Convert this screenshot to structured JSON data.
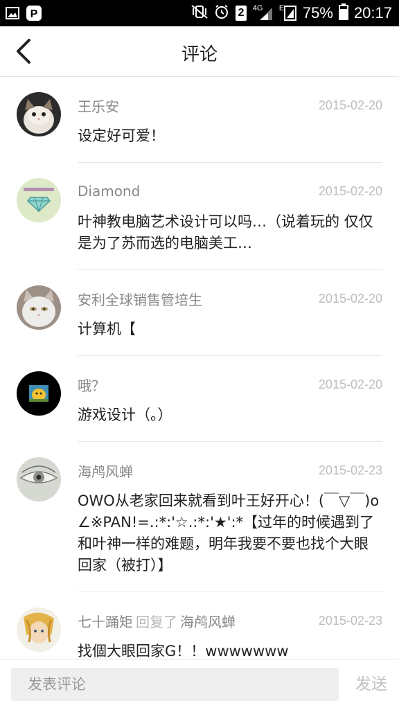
{
  "status_bar": {
    "network_type": "4G",
    "sim_slot": "2",
    "roaming_indicator": "E",
    "battery_percent": "75%",
    "time": "20:17"
  },
  "header": {
    "title": "评论"
  },
  "comments": [
    {
      "user": "王乐安",
      "date": "2015-02-20",
      "text": "设定好可爱！"
    },
    {
      "user": "Diamond",
      "date": "2015-02-20",
      "text": "叶神教电脑艺术设计可以吗…（说着玩的 仅仅是为了苏而选的电脑美工…"
    },
    {
      "user": "安利全球销售管培生",
      "date": "2015-02-20",
      "text": "计算机【"
    },
    {
      "user": "哦？",
      "date": "2015-02-20",
      "text": "游戏设计（。）"
    },
    {
      "user": "海鸬风蝉",
      "date": "2015-02-23",
      "text": "OWO从老家回来就看到叶王好开心！(￣▽￣)o∠※PAN!=.:*:'☆.:*:'★':*【过年的时候遇到了和叶神一样的难题，明年我要不要也找个大眼回家（被打）】"
    },
    {
      "user": "七十踊矩",
      "reply_word": "回复了",
      "reply_to": "海鸬风蝉",
      "date": "2015-02-23",
      "text": "找個大眼回家G！！wwwwwww"
    }
  ],
  "bottom_bar": {
    "input_placeholder": "发表评论",
    "send_label": "发送"
  }
}
